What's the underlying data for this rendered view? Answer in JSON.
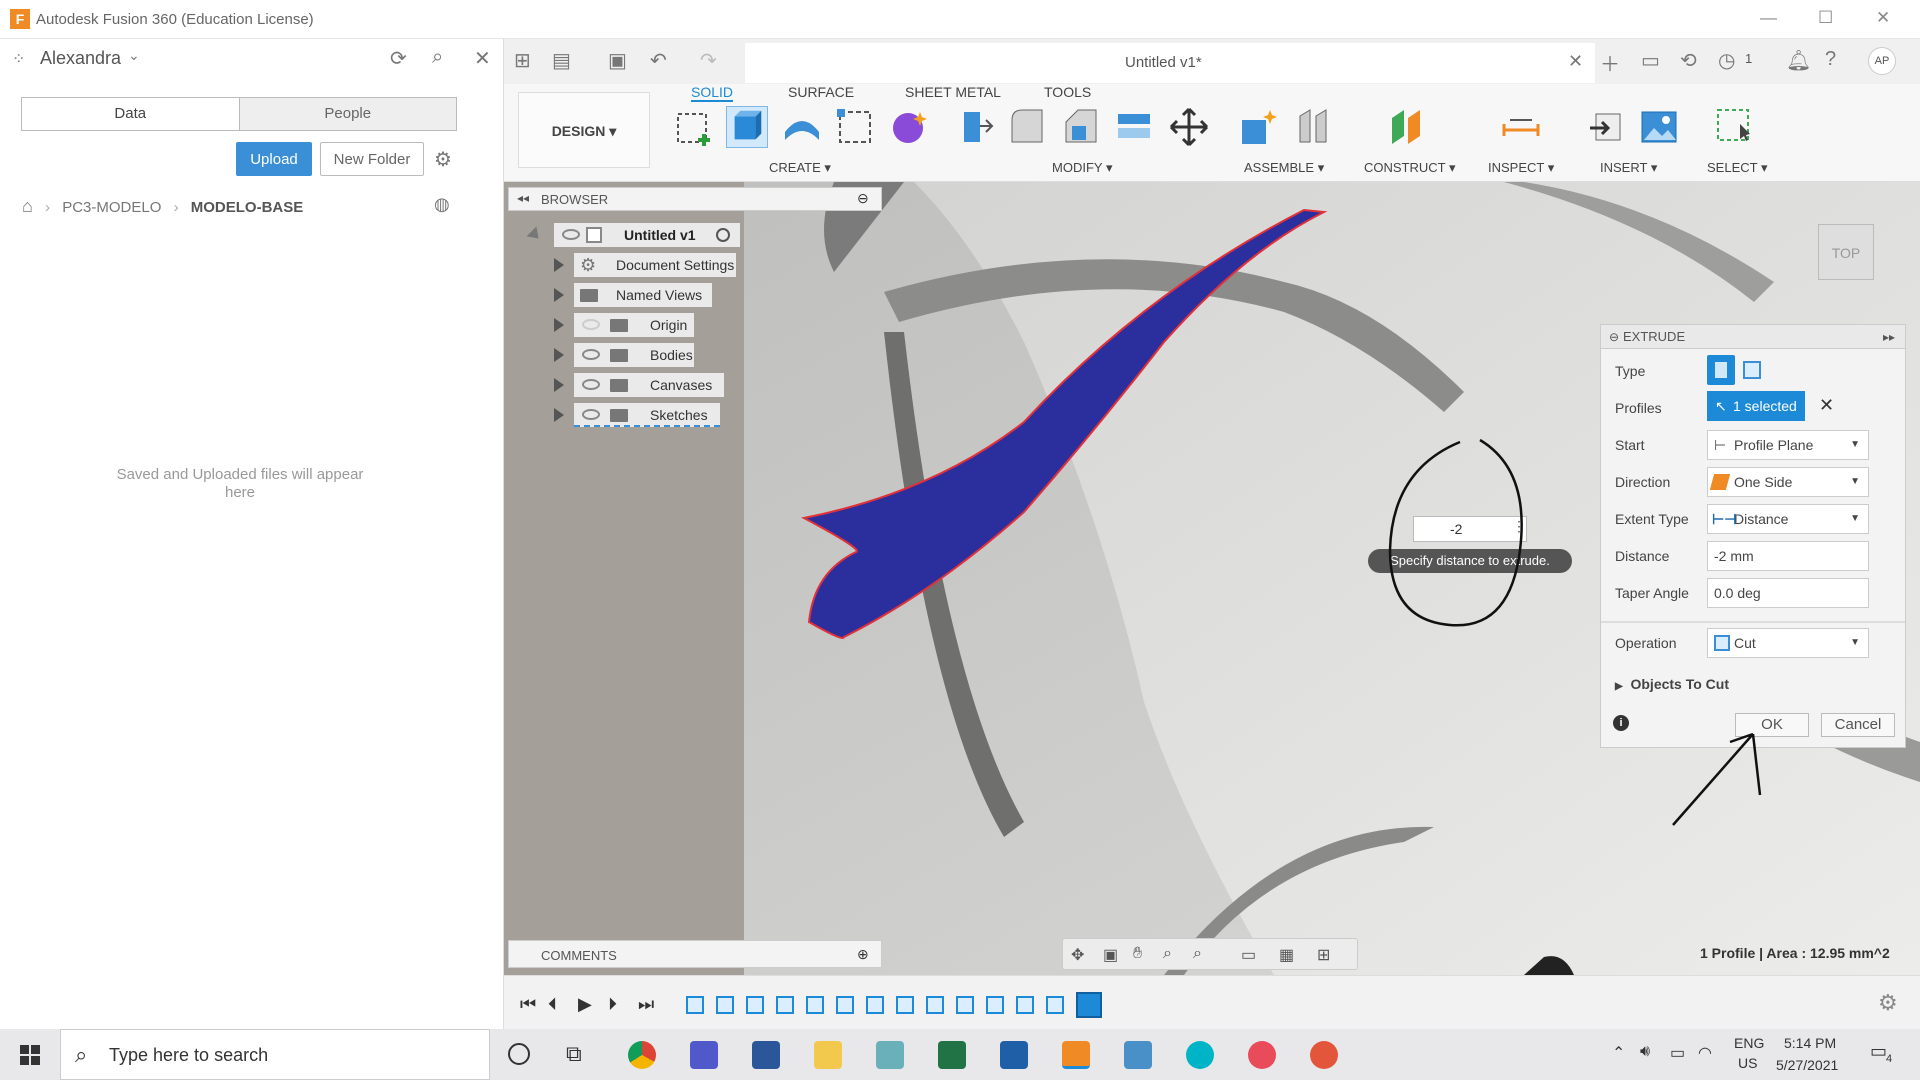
{
  "window": {
    "title": "Autodesk Fusion 360 (Education License)"
  },
  "data_panel": {
    "user": "Alexandra",
    "tabs": [
      "Data",
      "People"
    ],
    "upload_label": "Upload",
    "new_folder_label": "New Folder",
    "breadcrumb": [
      "PC3-MODELO",
      "MODELO-BASE"
    ],
    "empty_message": "Saved and Uploaded files will appear here"
  },
  "header": {
    "doc_title": "Untitled v1*",
    "jobs_count": "1",
    "user_initials": "AP"
  },
  "ribbon": {
    "workspace": "DESIGN",
    "tabs": [
      "SOLID",
      "SURFACE",
      "SHEET METAL",
      "TOOLS"
    ],
    "groups": [
      "CREATE",
      "MODIFY",
      "ASSEMBLE",
      "CONSTRUCT",
      "INSPECT",
      "INSERT",
      "SELECT"
    ]
  },
  "browser": {
    "title": "BROWSER",
    "root": "Untitled v1",
    "nodes": [
      "Document Settings",
      "Named Views",
      "Origin",
      "Bodies",
      "Canvases",
      "Sketches"
    ]
  },
  "extrude": {
    "title": "EXTRUDE",
    "labels": {
      "type": "Type",
      "profiles": "Profiles",
      "start": "Start",
      "direction": "Direction",
      "extent": "Extent Type",
      "distance": "Distance",
      "taper": "Taper Angle",
      "operation": "Operation",
      "objects": "Objects To Cut"
    },
    "profiles_value": "1 selected",
    "start_value": "Profile Plane",
    "direction_value": "One Side",
    "extent_value": "Distance",
    "distance_value": "-2 mm",
    "taper_value": "0.0 deg",
    "operation_value": "Cut",
    "ok_label": "OK",
    "cancel_label": "Cancel"
  },
  "viewport": {
    "dim_input": "-2",
    "tooltip": "Specify distance to extrude.",
    "viewcube": "TOP",
    "status": "1 Profile | Area : 12.95 mm^2"
  },
  "comments": {
    "title": "COMMENTS"
  },
  "taskbar": {
    "search_placeholder": "Type here to search",
    "lang": "ENG",
    "region": "US",
    "time": "5:14 PM",
    "date": "5/27/2021",
    "notif_count": "4"
  }
}
